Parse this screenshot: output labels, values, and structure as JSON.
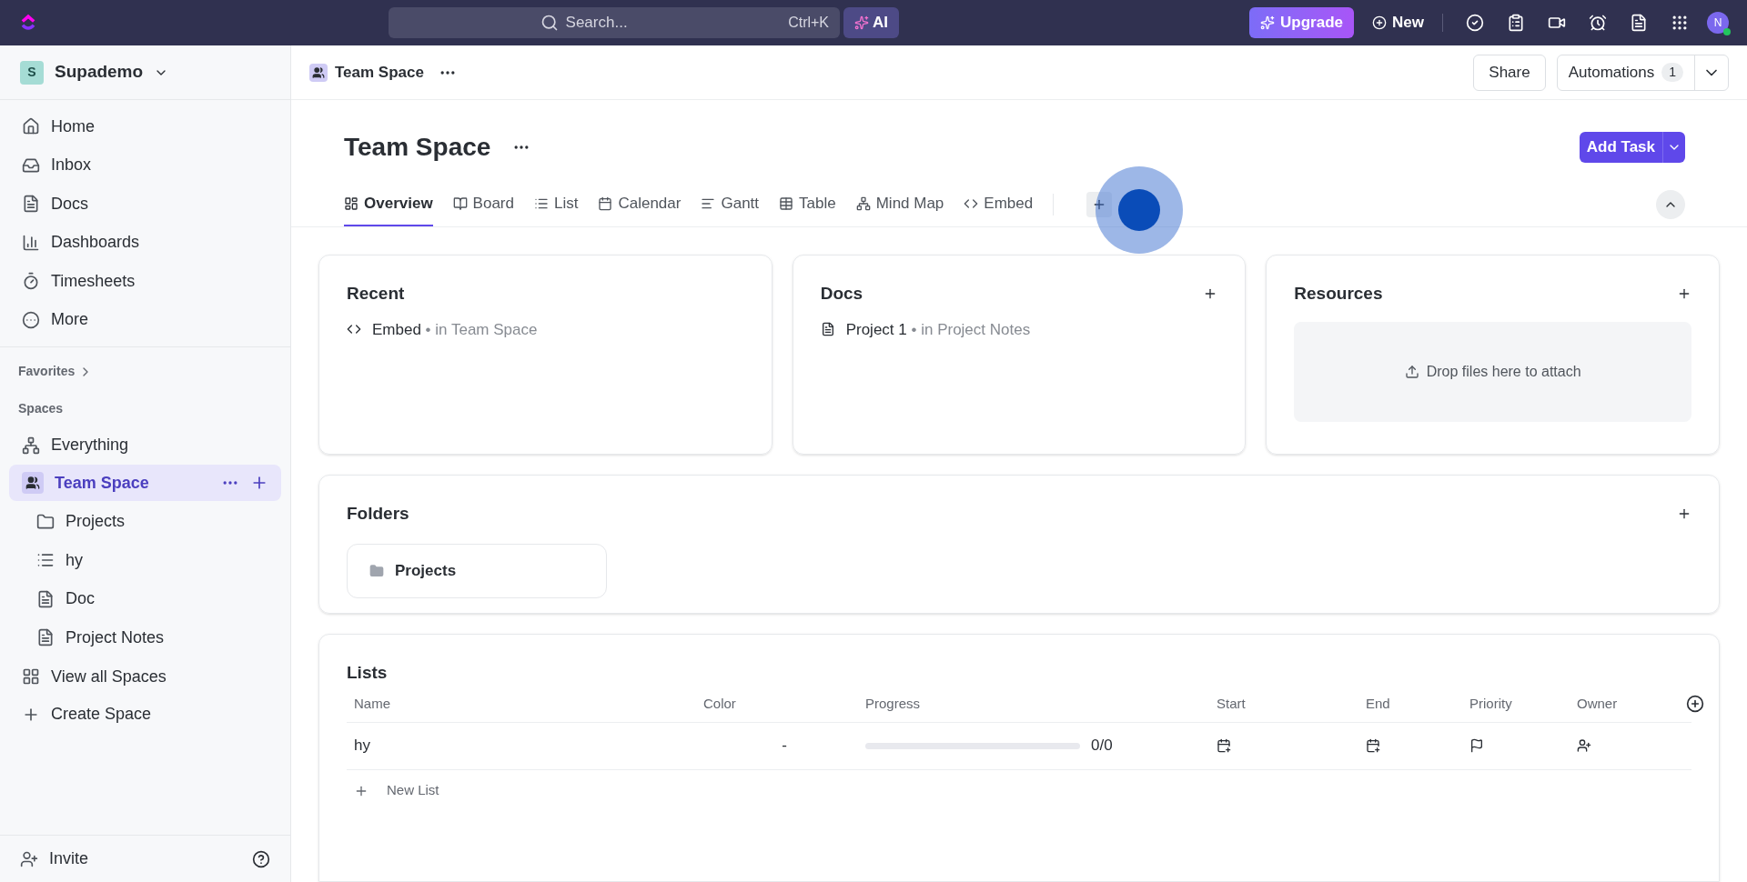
{
  "topbar": {
    "search": {
      "placeholder": "Search...",
      "shortcut": "Ctrl+K"
    },
    "ai_label": "AI",
    "upgrade_label": "Upgrade",
    "new_label": "New",
    "avatar": "N"
  },
  "sidebar": {
    "workspace": {
      "initial": "S",
      "name": "Supademo"
    },
    "nav": [
      {
        "kind": "home",
        "label": "Home"
      },
      {
        "kind": "inbox",
        "label": "Inbox"
      },
      {
        "kind": "doc",
        "label": "Docs"
      },
      {
        "kind": "chart",
        "label": "Dashboards"
      },
      {
        "kind": "timer",
        "label": "Timesheets"
      },
      {
        "kind": "more",
        "label": "More"
      }
    ],
    "favorites": "Favorites",
    "spaces_heading": "Spaces",
    "spaces": [
      {
        "kind": "everything",
        "label": "Everything",
        "selected": false
      },
      {
        "kind": "team",
        "label": "Team Space",
        "selected": true,
        "children": [
          {
            "kind": "folder",
            "label": "Projects"
          },
          {
            "kind": "list",
            "label": "hy"
          },
          {
            "kind": "doc",
            "label": "Doc"
          },
          {
            "kind": "doc",
            "label": "Project Notes"
          }
        ]
      },
      {
        "kind": "grid",
        "label": "View all Spaces",
        "selected": false
      },
      {
        "kind": "plus",
        "label": "Create Space",
        "selected": false
      }
    ],
    "invite": "Invite"
  },
  "header": {
    "breadcrumb": "Team Space",
    "share": "Share",
    "automations": "Automations",
    "automations_count": "1"
  },
  "title": "Team Space",
  "add_task": "Add Task",
  "tabs": [
    {
      "kind": "overview",
      "label": "Overview",
      "selected": true
    },
    {
      "kind": "board",
      "label": "Board",
      "selected": false
    },
    {
      "kind": "list",
      "label": "List",
      "selected": false
    },
    {
      "kind": "calendar",
      "label": "Calendar",
      "selected": false
    },
    {
      "kind": "gantt",
      "label": "Gantt",
      "selected": false
    },
    {
      "kind": "table",
      "label": "Table",
      "selected": false
    },
    {
      "kind": "mindmap",
      "label": "Mind Map",
      "selected": false
    },
    {
      "kind": "embed",
      "label": "Embed",
      "selected": false
    }
  ],
  "cards": {
    "recent": {
      "title": "Recent",
      "items": [
        {
          "kind": "embed",
          "name": "Embed",
          "separator": "•",
          "location": "in Team Space"
        }
      ]
    },
    "docs": {
      "title": "Docs",
      "items": [
        {
          "kind": "doc",
          "name": "Project 1",
          "separator": "•",
          "location": "in Project Notes"
        }
      ]
    },
    "resources": {
      "title": "Resources",
      "dropzone": "Drop files here to attach"
    }
  },
  "folders": {
    "title": "Folders",
    "items": [
      "Projects"
    ]
  },
  "lists": {
    "title": "Lists",
    "columns": [
      "Name",
      "Color",
      "Progress",
      "Start",
      "End",
      "Priority",
      "Owner"
    ],
    "rows": [
      {
        "name": "hy",
        "color_value": "-",
        "level": 0,
        "progress": "0/0"
      }
    ],
    "new_list": "New List"
  }
}
